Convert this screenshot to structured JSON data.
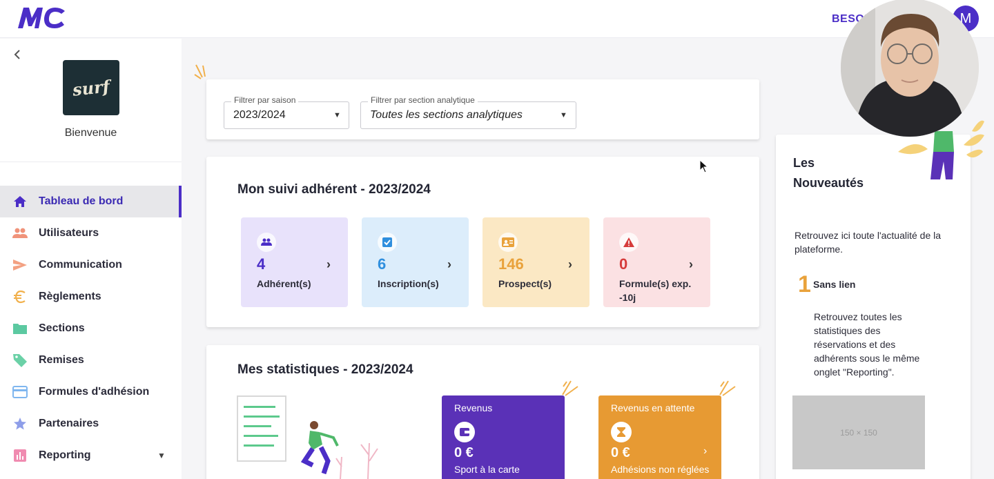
{
  "header": {
    "logo_text": "MC",
    "help_label": "BESOIN",
    "user_initial": "M"
  },
  "sidebar": {
    "welcome": "Bienvenue",
    "club_logo_text": "surf",
    "items": [
      {
        "label": "Tableau de bord",
        "icon": "home-icon",
        "color": "#4b2ec7"
      },
      {
        "label": "Utilisateurs",
        "icon": "users-icon",
        "color": "#f0937a"
      },
      {
        "label": "Communication",
        "icon": "send-icon",
        "color": "#f3a182"
      },
      {
        "label": "Règlements",
        "icon": "euro-icon",
        "color": "#f1b04b"
      },
      {
        "label": "Sections",
        "icon": "folder-icon",
        "color": "#5cc9a1"
      },
      {
        "label": "Remises",
        "icon": "tag-icon",
        "color": "#6bd1a7"
      },
      {
        "label": "Formules d'adhésion",
        "icon": "card-icon",
        "color": "#7fb6ef"
      },
      {
        "label": "Partenaires",
        "icon": "star-icon",
        "color": "#8e9ee9"
      },
      {
        "label": "Reporting",
        "icon": "chart-icon",
        "color": "#f08bb0"
      }
    ]
  },
  "filters": {
    "season_label": "Filtrer par saison",
    "season_value": "2023/2024",
    "section_label": "Filtrer par section analytique",
    "section_value": "Toutes les sections analytiques"
  },
  "suivi": {
    "title": "Mon suivi adhérent - 2023/2024",
    "stats": [
      {
        "value": "4",
        "label": "Adhérent(s)",
        "bg": "#e8e2fb",
        "color": "#4b2ec7",
        "icon": "group-icon"
      },
      {
        "value": "6",
        "label": "Inscription(s)",
        "bg": "#dcedfb",
        "color": "#2f8fde",
        "icon": "checkbox-icon"
      },
      {
        "value": "146",
        "label": "Prospect(s)",
        "bg": "#fbe8c4",
        "color": "#e9a23b",
        "icon": "contact-card-icon"
      },
      {
        "value": "0",
        "label": "Formule(s) exp. -10j",
        "bg": "#fbe1e3",
        "color": "#d63b3b",
        "icon": "warning-icon"
      }
    ]
  },
  "statistiques": {
    "title": "Mes statistiques - 2023/2024",
    "revenus": {
      "title": "Revenus",
      "value": "0 €",
      "sub": "Sport à la carte",
      "bg": "#5a31b7"
    },
    "attente": {
      "title": "Revenus en attente",
      "value": "0 €",
      "sub": "Adhésions non réglées",
      "bg": "#e79a33"
    }
  },
  "news": {
    "title_line1": "Les",
    "title_line2": "Nouveautés",
    "intro": "Retrouvez ici toute l'actualité de la plateforme.",
    "item_number": "1",
    "item_title": "Sans lien",
    "item_desc": "Retrouvez toutes les statistiques des réservations et des adhérents sous le même onglet \"Reporting\".",
    "placeholder": "150 × 150"
  }
}
